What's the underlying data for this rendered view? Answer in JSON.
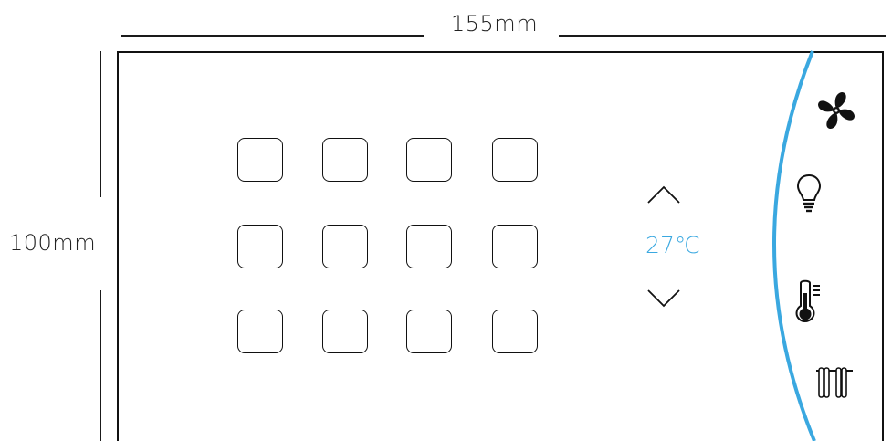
{
  "dimensions": {
    "width_label": "155mm",
    "height_label": "100mm"
  },
  "thermostat": {
    "temperature": "27℃",
    "increase_icon": "chevron-up-icon",
    "decrease_icon": "chevron-down-icon"
  },
  "scene_buttons": {
    "rows": 3,
    "columns": 4
  },
  "side_menu": {
    "items": [
      "fan-icon",
      "lightbulb-icon",
      "thermometer-icon",
      "radiator-icon"
    ]
  },
  "colors": {
    "accent": "#3aa8e0",
    "outline": "#111111"
  }
}
